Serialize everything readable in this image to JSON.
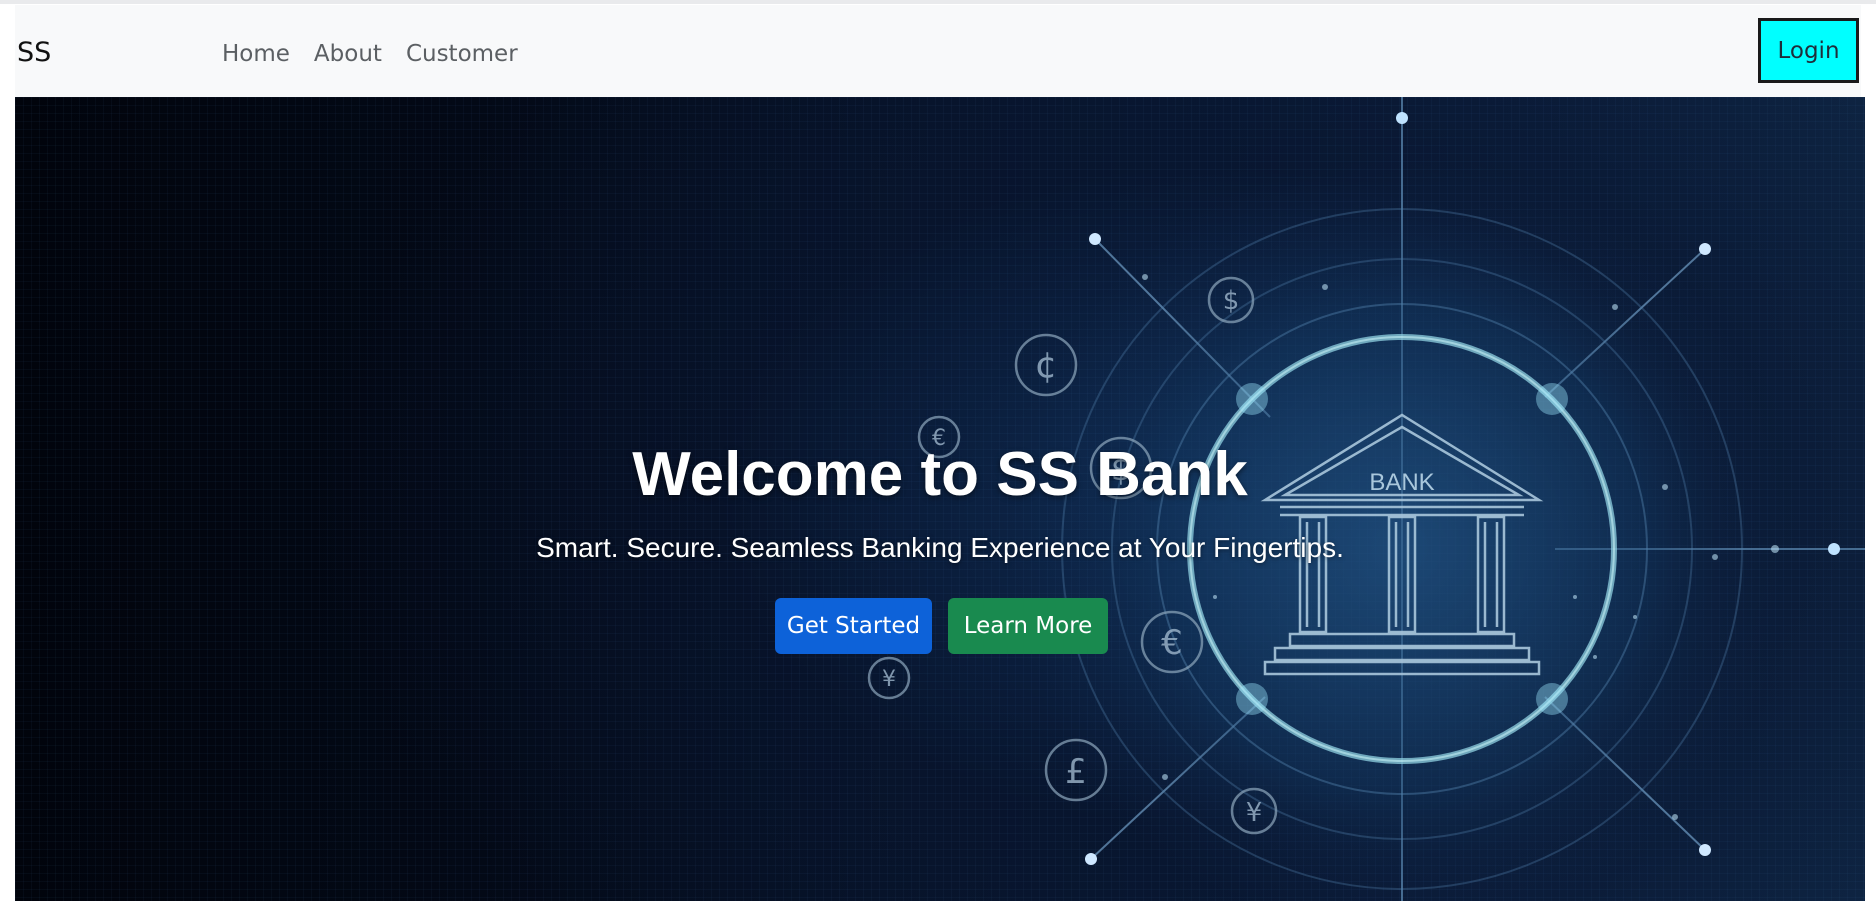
{
  "navbar": {
    "brand": "SS",
    "links": [
      "Home",
      "About",
      "Customer"
    ],
    "login_label": "Login"
  },
  "hero": {
    "title": "Welcome to SS Bank",
    "subtitle": "Smart. Secure. Seamless Banking Experience at Your Fingertips.",
    "primary_button": "Get Started",
    "secondary_button": "Learn More",
    "image_sign": "BANK",
    "currency_symbols": [
      "$",
      "¢",
      "€",
      "£",
      "¥",
      "¥",
      "€",
      "$"
    ]
  },
  "colors": {
    "navbar_bg": "#f8f9fa",
    "login_bg": "#00ffff",
    "primary": "#0d62d9",
    "success": "#198a4f",
    "hero_bg": "#07142b"
  },
  "icons": {
    "bank": "bank-building-icon",
    "currency": "currency-coin-icon"
  }
}
